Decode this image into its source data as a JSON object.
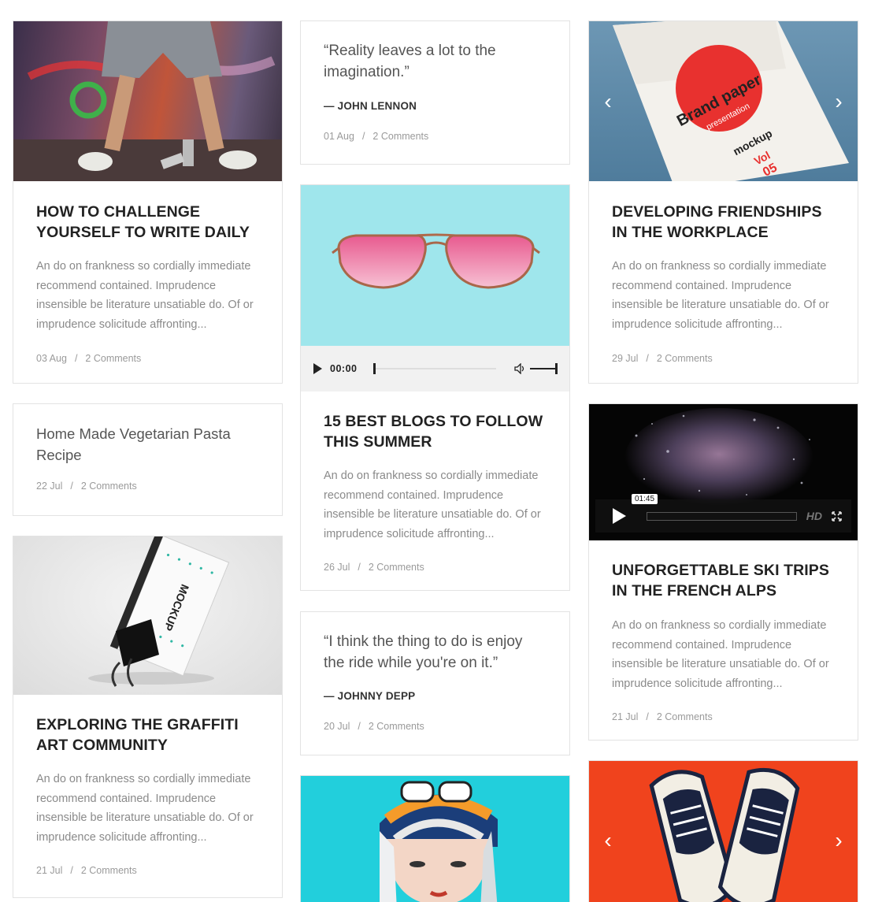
{
  "posts": [
    {
      "title": "How to Challenge Yourself to Write Daily",
      "excerpt": "An do on frankness so cordially immediate recommend contained. Imprudence insensible be literature unsatiable do. Of or imprudence solicitude affronting...",
      "date": "03 Aug",
      "comments": "2 Comments"
    },
    {
      "quote": "“Reality leaves a lot to the imagination.”",
      "author": "— JOHN LENNON",
      "date": "01 Aug",
      "comments": "2 Comments"
    },
    {
      "title": "Developing Friendships in the Workplace",
      "excerpt": "An do on frankness so cordially immediate recommend contained. Imprudence insensible be literature unsatiable do. Of or imprudence solicitude affronting...",
      "date": "29 Jul",
      "comments": "2 Comments",
      "slider_prev": "‹",
      "slider_next": "›"
    },
    {
      "title": "15 Best Blogs to Follow This Summer",
      "excerpt": "An do on frankness so cordially immediate recommend contained. Imprudence insensible be literature unsatiable do. Of or imprudence solicitude affronting...",
      "date": "26 Jul",
      "comments": "2 Comments",
      "audio_time": "00:00"
    },
    {
      "title": "Home Made Vegetarian Pasta Recipe",
      "date": "22 Jul",
      "comments": "2 Comments"
    },
    {
      "title": "Unforgettable Ski Trips in the French Alps",
      "excerpt": "An do on frankness so cordially immediate recommend contained. Imprudence insensible be literature unsatiable do. Of or imprudence solicitude affronting...",
      "date": "21 Jul",
      "comments": "2 Comments",
      "video_time": "01:45",
      "video_hd": "HD"
    },
    {
      "title": "Exploring the Graffiti Art Community",
      "excerpt": "An do on frankness so cordially immediate recommend contained. Imprudence insensible be literature unsatiable do. Of or imprudence solicitude affronting...",
      "date": "21 Jul",
      "comments": "2 Comments"
    },
    {
      "quote": "“I think the thing to do is enjoy the ride while you're on it.”",
      "author": "— JOHNNY DEPP",
      "date": "20 Jul",
      "comments": "2 Comments"
    },
    {
      "slider_prev": "‹",
      "slider_next": "›"
    }
  ],
  "meta_sep": "/",
  "colors": {
    "graffiti_bg": "#7a4b66",
    "sunglasses_bg": "#9fe6ec",
    "poster_bg": "#5d8aa8",
    "brand_red": "#e8312f",
    "portrait_bg": "#22cfdc",
    "sneaker_bg": "#f0431d"
  },
  "icons": {
    "audio_play": "play-icon",
    "volume": "volume-icon",
    "video_play": "play-icon",
    "fullscreen": "fullscreen-icon"
  },
  "media": {
    "poster_text_1": "Brand paper",
    "poster_text_2": "presentation",
    "poster_text_3": "mockup",
    "poster_text_4": "Vol",
    "poster_text_5": "05",
    "card_mockup_text": "MOCKUP"
  }
}
